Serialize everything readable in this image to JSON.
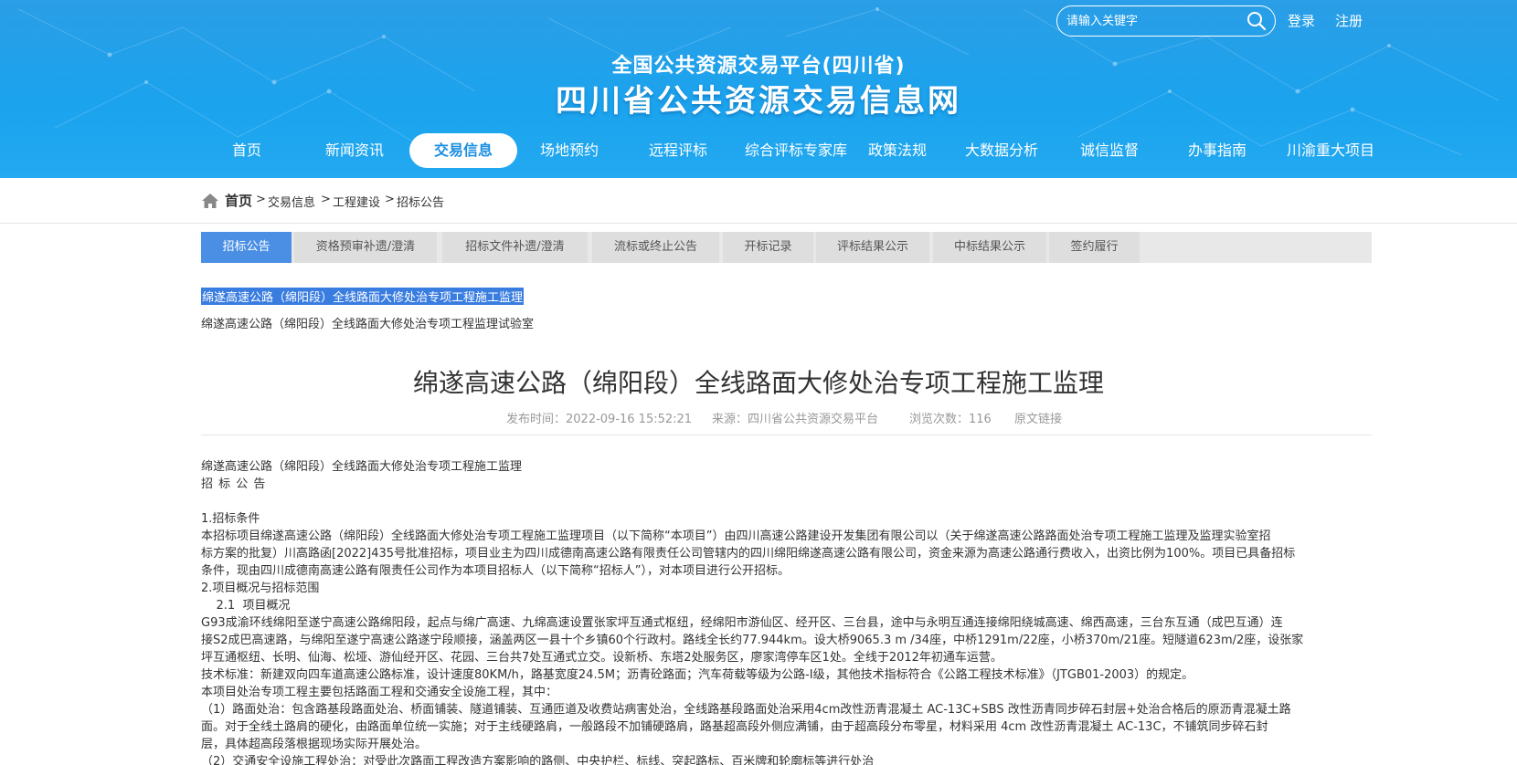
{
  "header": {
    "search_placeholder": "请输入关键字",
    "login": "登录",
    "register": "注册",
    "subtitle": "全国公共资源交易平台(四川省)",
    "title": "四川省公共资源交易信息网"
  },
  "nav": {
    "items": [
      "首页",
      "新闻资讯",
      "交易信息",
      "场地预约",
      "远程评标",
      "综合评标专家库",
      "政策法规",
      "大数据分析",
      "诚信监督",
      "办事指南",
      "川渝重大项目"
    ],
    "active": "交易信息"
  },
  "breadcrumb": {
    "home": "首页",
    "sep": ">",
    "items": [
      "交易信息",
      "工程建设",
      "招标公告"
    ]
  },
  "tabs": {
    "items": [
      "招标公告",
      "资格预审补遗/澄清",
      "招标文件补遗/澄清",
      "流标或终止公告",
      "开标记录",
      "评标结果公示",
      "中标结果公示",
      "签约履行"
    ],
    "active": "招标公告"
  },
  "related_links": [
    "绵遂高速公路（绵阳段）全线路面大修处治专项工程施工监理",
    "绵遂高速公路（绵阳段）全线路面大修处治专项工程监理试验室"
  ],
  "article": {
    "title": "绵遂高速公路（绵阳段）全线路面大修处治专项工程施工监理",
    "meta": {
      "publish_time": "发布时间：2022-09-16 15:52:21",
      "source": "来源：四川省公共资源交易平台",
      "views": "浏览次数：116",
      "original_link": "原文链接"
    },
    "lines": [
      "绵遂高速公路（绵阳段）全线路面大修处治专项工程施工监理",
      "招 标 公 告",
      "",
      "1.招标条件",
      "本招标项目绵遂高速公路（绵阳段）全线路面大修处治专项工程施工监理项目（以下简称“本项目”）由四川高速公路建设开发集团有限公司以（关于绵遂高速公路路面处治专项工程施工监理及监理实验室招",
      "标方案的批复）川高路函[2022]435号批准招标，项目业主为四川成德南高速公路有限责任公司管辖内的四川绵阳绵遂高速公路有限公司，资金来源为高速公路通行费收入，出资比例为100%。项目已具备招标",
      "条件，现由四川成德南高速公路有限责任公司作为本项目招标人（以下简称“招标人”），对本项目进行公开招标。",
      "2.项目概况与招标范围",
      "    2.1  项目概况",
      "G93成渝环线绵阳至遂宁高速公路绵阳段，起点与绵广高速、九绵高速设置张家坪互通式枢纽，经绵阳市游仙区、经开区、三台县，途中与永明互通连接绵阳绕城高速、绵西高速，三台东互通（成巴互通）连",
      "接S2成巴高速路，与绵阳至遂宁高速公路遂宁段顺接，涵盖两区一县十个乡镇60个行政村。路线全长约77.944km。设大桥9065.3 m /34座，中桥1291m/22座，小桥370m/21座。短隧道623m/2座，设张家",
      "坪互通枢纽、长明、仙海、松垭、游仙经开区、花园、三台共7处互通式立交。设新桥、东塔2处服务区，廖家湾停车区1处。全线于2012年初通车运营。",
      "技术标准：新建双向四车道高速公路标准，设计速度80KM/h，路基宽度24.5M；沥青砼路面；汽车荷载等级为公路-Ⅰ级，其他技术指标符合《公路工程技术标准》（JTGB01-2003）的规定。",
      "本项目处治专项工程主要包括路面工程和交通安全设施工程，其中：",
      "（1）路面处治：包含路基段路面处治、桥面铺装、隧道铺装、互通匝道及收费站病害处治，全线路基段路面处治采用4cm改性沥青混凝土 AC-13C+SBS 改性沥青同步碎石封层+处治合格后的原沥青混凝土路",
      "面。对于全线土路肩的硬化，由路面单位统一实施；对于主线硬路肩，一般路段不加铺硬路肩，路基超高段外侧应满铺，由于超高段分布零星，材料采用 4cm 改性沥青混凝土 AC-13C，不铺筑同步碎石封",
      "层，具体超高段落根据现场实际开展处治。",
      "（2）交通安全设施工程处治：对受此次路面工程改造方案影响的路侧、中央护栏、标线、突起路标、百米牌和轮廓标等进行处治"
    ]
  }
}
